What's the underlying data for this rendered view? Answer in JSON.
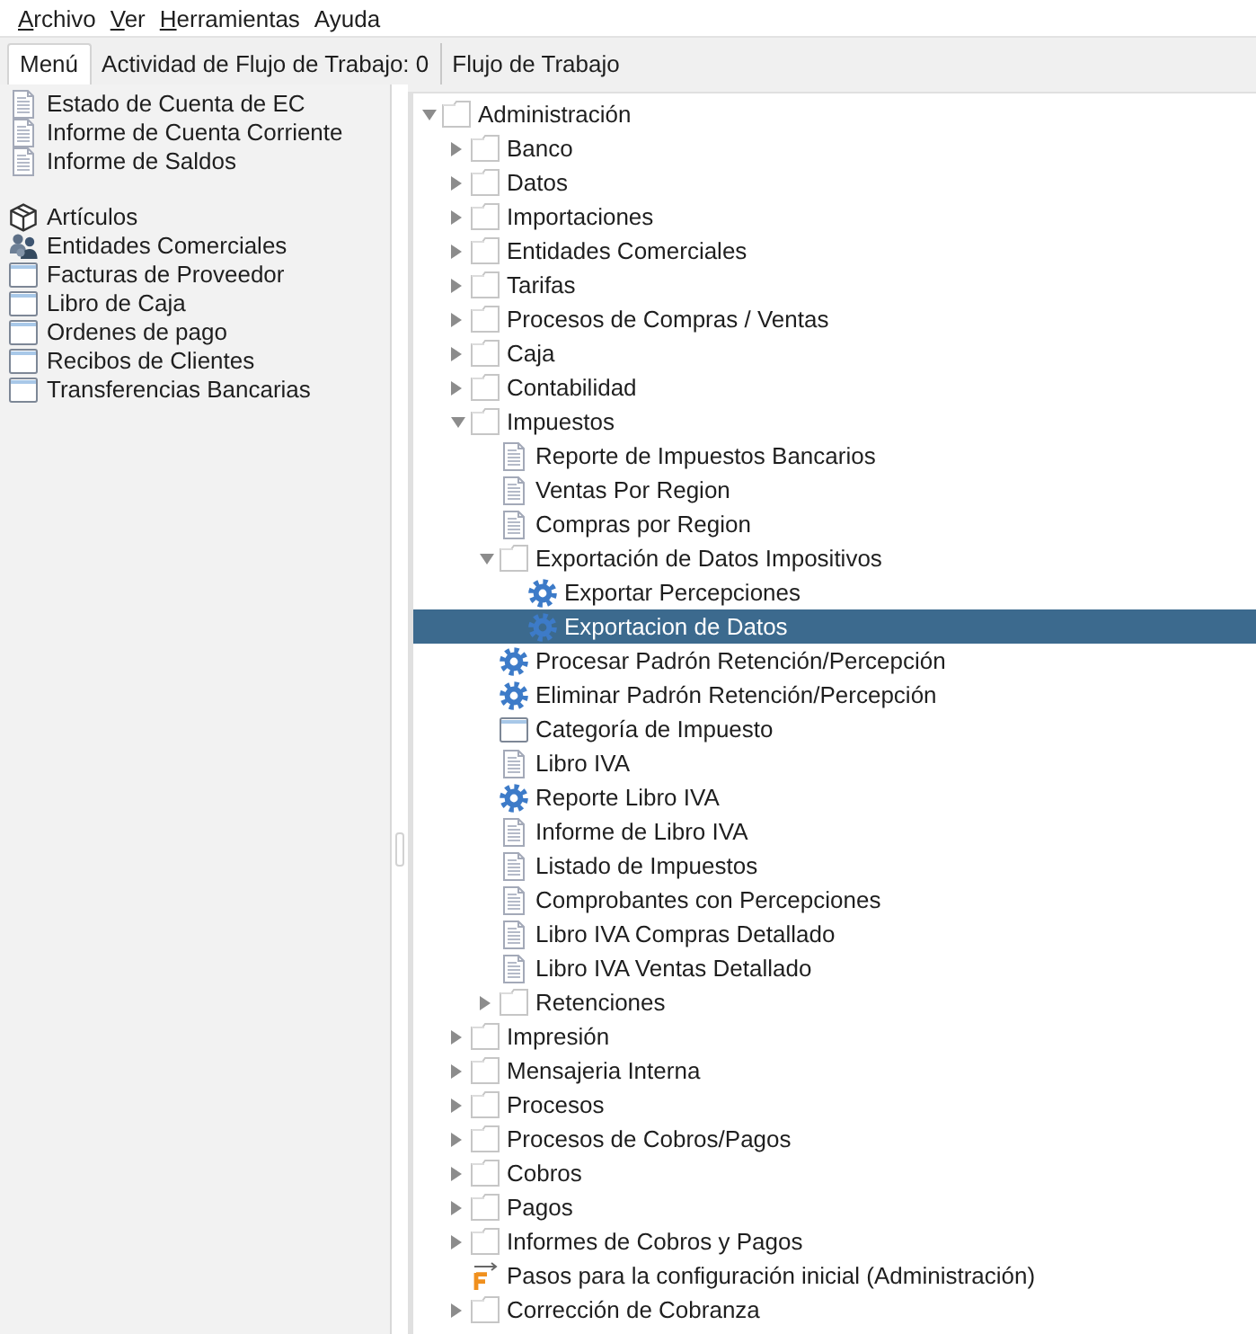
{
  "menu_bar": [
    {
      "label": "Archivo",
      "mnemonic": true
    },
    {
      "label": "Ver",
      "mnemonic": true
    },
    {
      "label": "Herramientas",
      "mnemonic": true
    },
    {
      "label": "Ayuda",
      "mnemonic": false
    }
  ],
  "tabs": [
    {
      "label": "Menú",
      "selected": true
    },
    {
      "label": "Actividad de Flujo de Trabajo: 0",
      "selected": false
    },
    {
      "label": "Flujo de Trabajo",
      "selected": false
    }
  ],
  "left_panel": {
    "groups": [
      [
        {
          "label": "Estado de Cuenta de EC",
          "kind": "report"
        },
        {
          "label": "Informe de Cuenta Corriente",
          "kind": "report"
        },
        {
          "label": "Informe de Saldos",
          "kind": "report"
        }
      ],
      [
        {
          "label": "Artículos",
          "kind": "product"
        },
        {
          "label": "Entidades Comerciales",
          "kind": "partner"
        },
        {
          "label": "Facturas de Proveedor",
          "kind": "window"
        },
        {
          "label": "Libro de Caja",
          "kind": "window"
        },
        {
          "label": "Ordenes de pago",
          "kind": "window"
        },
        {
          "label": "Recibos de Clientes",
          "kind": "window"
        },
        {
          "label": "Transferencias Bancarias",
          "kind": "window"
        }
      ]
    ]
  },
  "tree": {
    "nodes": [
      {
        "label": "Administración",
        "kind": "folder",
        "expanded": true,
        "selected": false,
        "children": [
          {
            "label": "Banco",
            "kind": "folder",
            "expanded": false,
            "selected": false
          },
          {
            "label": "Datos",
            "kind": "folder",
            "expanded": false,
            "selected": false
          },
          {
            "label": "Importaciones",
            "kind": "folder",
            "expanded": false,
            "selected": false
          },
          {
            "label": "Entidades Comerciales",
            "kind": "folder",
            "expanded": false,
            "selected": false
          },
          {
            "label": "Tarifas",
            "kind": "folder",
            "expanded": false,
            "selected": false
          },
          {
            "label": "Procesos de Compras / Ventas",
            "kind": "folder",
            "expanded": false,
            "selected": false
          },
          {
            "label": "Caja",
            "kind": "folder",
            "expanded": false,
            "selected": false
          },
          {
            "label": "Contabilidad",
            "kind": "folder",
            "expanded": false,
            "selected": false
          },
          {
            "label": "Impuestos",
            "kind": "folder",
            "expanded": true,
            "selected": false,
            "children": [
              {
                "label": "Reporte de Impuestos Bancarios",
                "kind": "report",
                "selected": false
              },
              {
                "label": "Ventas Por Region",
                "kind": "report",
                "selected": false
              },
              {
                "label": "Compras por Region",
                "kind": "report",
                "selected": false
              },
              {
                "label": "Exportación de Datos Impositivos",
                "kind": "folder",
                "expanded": true,
                "selected": false,
                "children": [
                  {
                    "label": "Exportar Percepciones",
                    "kind": "process",
                    "selected": false
                  },
                  {
                    "label": "Exportacion de Datos",
                    "kind": "process",
                    "selected": true
                  }
                ]
              },
              {
                "label": "Procesar Padrón Retención/Percepción",
                "kind": "process",
                "selected": false
              },
              {
                "label": "Eliminar Padrón Retención/Percepción",
                "kind": "process",
                "selected": false
              },
              {
                "label": "Categoría de Impuesto",
                "kind": "window",
                "selected": false
              },
              {
                "label": "Libro IVA",
                "kind": "report",
                "selected": false
              },
              {
                "label": "Reporte Libro IVA",
                "kind": "process",
                "selected": false
              },
              {
                "label": "Informe de Libro IVA",
                "kind": "report",
                "selected": false
              },
              {
                "label": "Listado de Impuestos",
                "kind": "report",
                "selected": false
              },
              {
                "label": "Comprobantes con Percepciones",
                "kind": "report",
                "selected": false
              },
              {
                "label": "Libro IVA Compras Detallado",
                "kind": "report",
                "selected": false
              },
              {
                "label": "Libro IVA Ventas Detallado",
                "kind": "report",
                "selected": false
              },
              {
                "label": "Retenciones",
                "kind": "folder",
                "expanded": false,
                "selected": false
              }
            ]
          },
          {
            "label": "Impresión",
            "kind": "folder",
            "expanded": false,
            "selected": false
          },
          {
            "label": "Mensajeria Interna",
            "kind": "folder",
            "expanded": false,
            "selected": false
          },
          {
            "label": "Procesos",
            "kind": "folder",
            "expanded": false,
            "selected": false
          },
          {
            "label": "Procesos de Cobros/Pagos",
            "kind": "folder",
            "expanded": false,
            "selected": false
          },
          {
            "label": "Cobros",
            "kind": "folder",
            "expanded": false,
            "selected": false
          },
          {
            "label": "Pagos",
            "kind": "folder",
            "expanded": false,
            "selected": false
          },
          {
            "label": "Informes de Cobros y Pagos",
            "kind": "folder",
            "expanded": false,
            "selected": false
          },
          {
            "label": "Pasos para la configuración inicial (Administración)",
            "kind": "workflow",
            "selected": false
          },
          {
            "label": "Corrección de Cobranza",
            "kind": "folder",
            "expanded": false,
            "selected": false
          }
        ]
      }
    ]
  }
}
